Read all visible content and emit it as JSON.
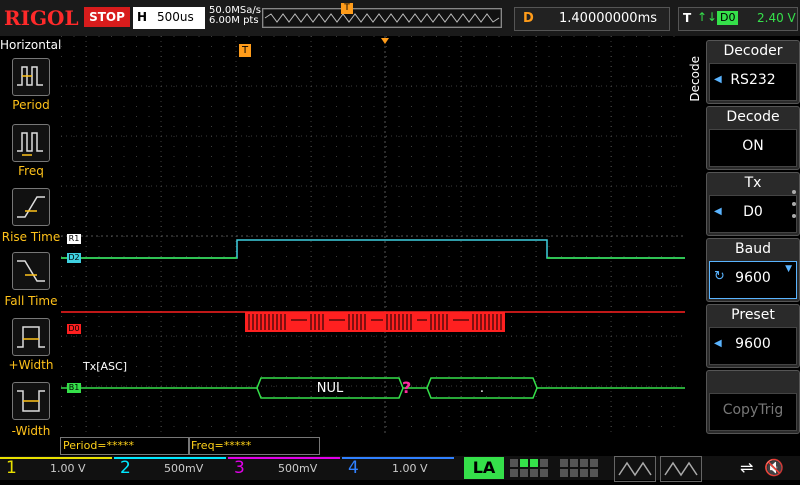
{
  "brand": "RIGOL",
  "run_state": "STOP",
  "horizontal": {
    "label": "H",
    "timebase": "500us"
  },
  "sample_rate": "50.0MSa/s",
  "memory_depth": "6.00M pts",
  "delay": {
    "label": "D",
    "value": "1.40000000ms"
  },
  "trigger": {
    "label": "T",
    "channel": "D0",
    "level": "2.40 V"
  },
  "left_menu": {
    "title": "Horizontal",
    "items": [
      {
        "label": "Period",
        "icon": "period-icon"
      },
      {
        "label": "Freq",
        "icon": "freq-icon"
      },
      {
        "label": "Rise Time",
        "icon": "rise-time-icon"
      },
      {
        "label": "Fall Time",
        "icon": "fall-time-icon"
      },
      {
        "label": "+Width",
        "icon": "positive-width-icon"
      },
      {
        "label": "-Width",
        "icon": "negative-width-icon"
      }
    ]
  },
  "right_menu": {
    "side_label": "Decode",
    "items": [
      {
        "title": "Decoder",
        "value": "RS232"
      },
      {
        "title": "Decode",
        "value": "ON"
      },
      {
        "title": "Tx",
        "value": "D0"
      },
      {
        "title": "Baud",
        "value": "9600"
      },
      {
        "title": "Preset",
        "value": "9600"
      },
      {
        "title": "",
        "value": "CopyTrig"
      }
    ]
  },
  "traces": {
    "r1_label": "R1",
    "d2_label": "D2",
    "d0_label": "D0",
    "b1_label": "B1",
    "trigger_marker": "T",
    "decode_label": "Tx[ASC]",
    "packet1": "NUL",
    "error_mark": "?",
    "packet2": "."
  },
  "measurements": {
    "period": "Period=*****",
    "freq": "Freq=*****"
  },
  "channels": [
    {
      "number": "1",
      "scale": "1.00 V",
      "color": "#e8e000"
    },
    {
      "number": "2",
      "scale": "500mV",
      "color": "#00e8ff"
    },
    {
      "number": "3",
      "scale": "500mV",
      "color": "#e000e8"
    },
    {
      "number": "4",
      "scale": "1.00 V",
      "color": "#3080ff"
    }
  ],
  "la_label": "LA",
  "colors": {
    "accent": "#35e04a",
    "cyan": "#3fd0e0",
    "red": "#ff2020",
    "orange": "#ff9c1a"
  }
}
